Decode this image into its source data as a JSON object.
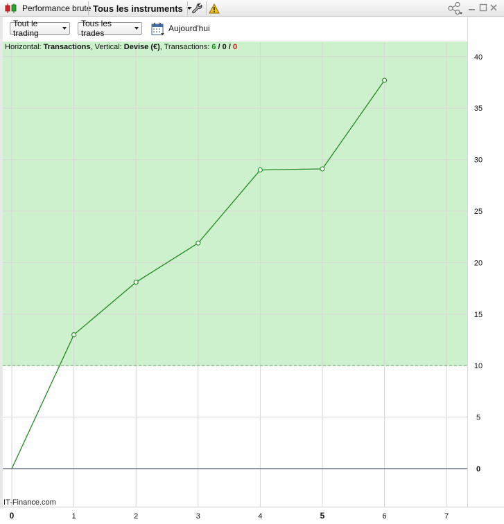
{
  "titlebar": {
    "performance_label": "Performance brute",
    "instruments_label": "Tous les instruments"
  },
  "toolbar": {
    "trading_filter": "Tout le trading",
    "trades_filter": "Tous les trades",
    "date_label": "Aujourd'hui"
  },
  "info": {
    "horizontal_prefix": "Horizontal: ",
    "horizontal_value": "Transactions",
    "vertical_prefix": ", Vertical: ",
    "vertical_value": "Devise (€)",
    "transactions_prefix": ", Transactions: ",
    "count_total": "6",
    "count_mid": "0",
    "count_neg": "0",
    "slash": " / "
  },
  "watermark": "IT-Finance.com",
  "colors": {
    "line": "#1f8a1f",
    "fill": "#cdf0cd",
    "zero_line": "#2a3446",
    "grid": "#d6d6d6"
  },
  "chart_data": {
    "type": "line",
    "x": [
      0,
      1,
      2,
      3,
      4,
      5,
      6
    ],
    "y": [
      0,
      13.0,
      18.1,
      21.9,
      29.0,
      29.1,
      37.7
    ],
    "xlim": [
      0,
      7
    ],
    "ylim": [
      0,
      42
    ],
    "x_ticks": [
      0,
      1,
      2,
      3,
      4,
      5,
      6,
      7
    ],
    "y_ticks": [
      0,
      5,
      10,
      15,
      20,
      25,
      30,
      35,
      40
    ],
    "shaded_threshold": 10,
    "grid": true
  }
}
